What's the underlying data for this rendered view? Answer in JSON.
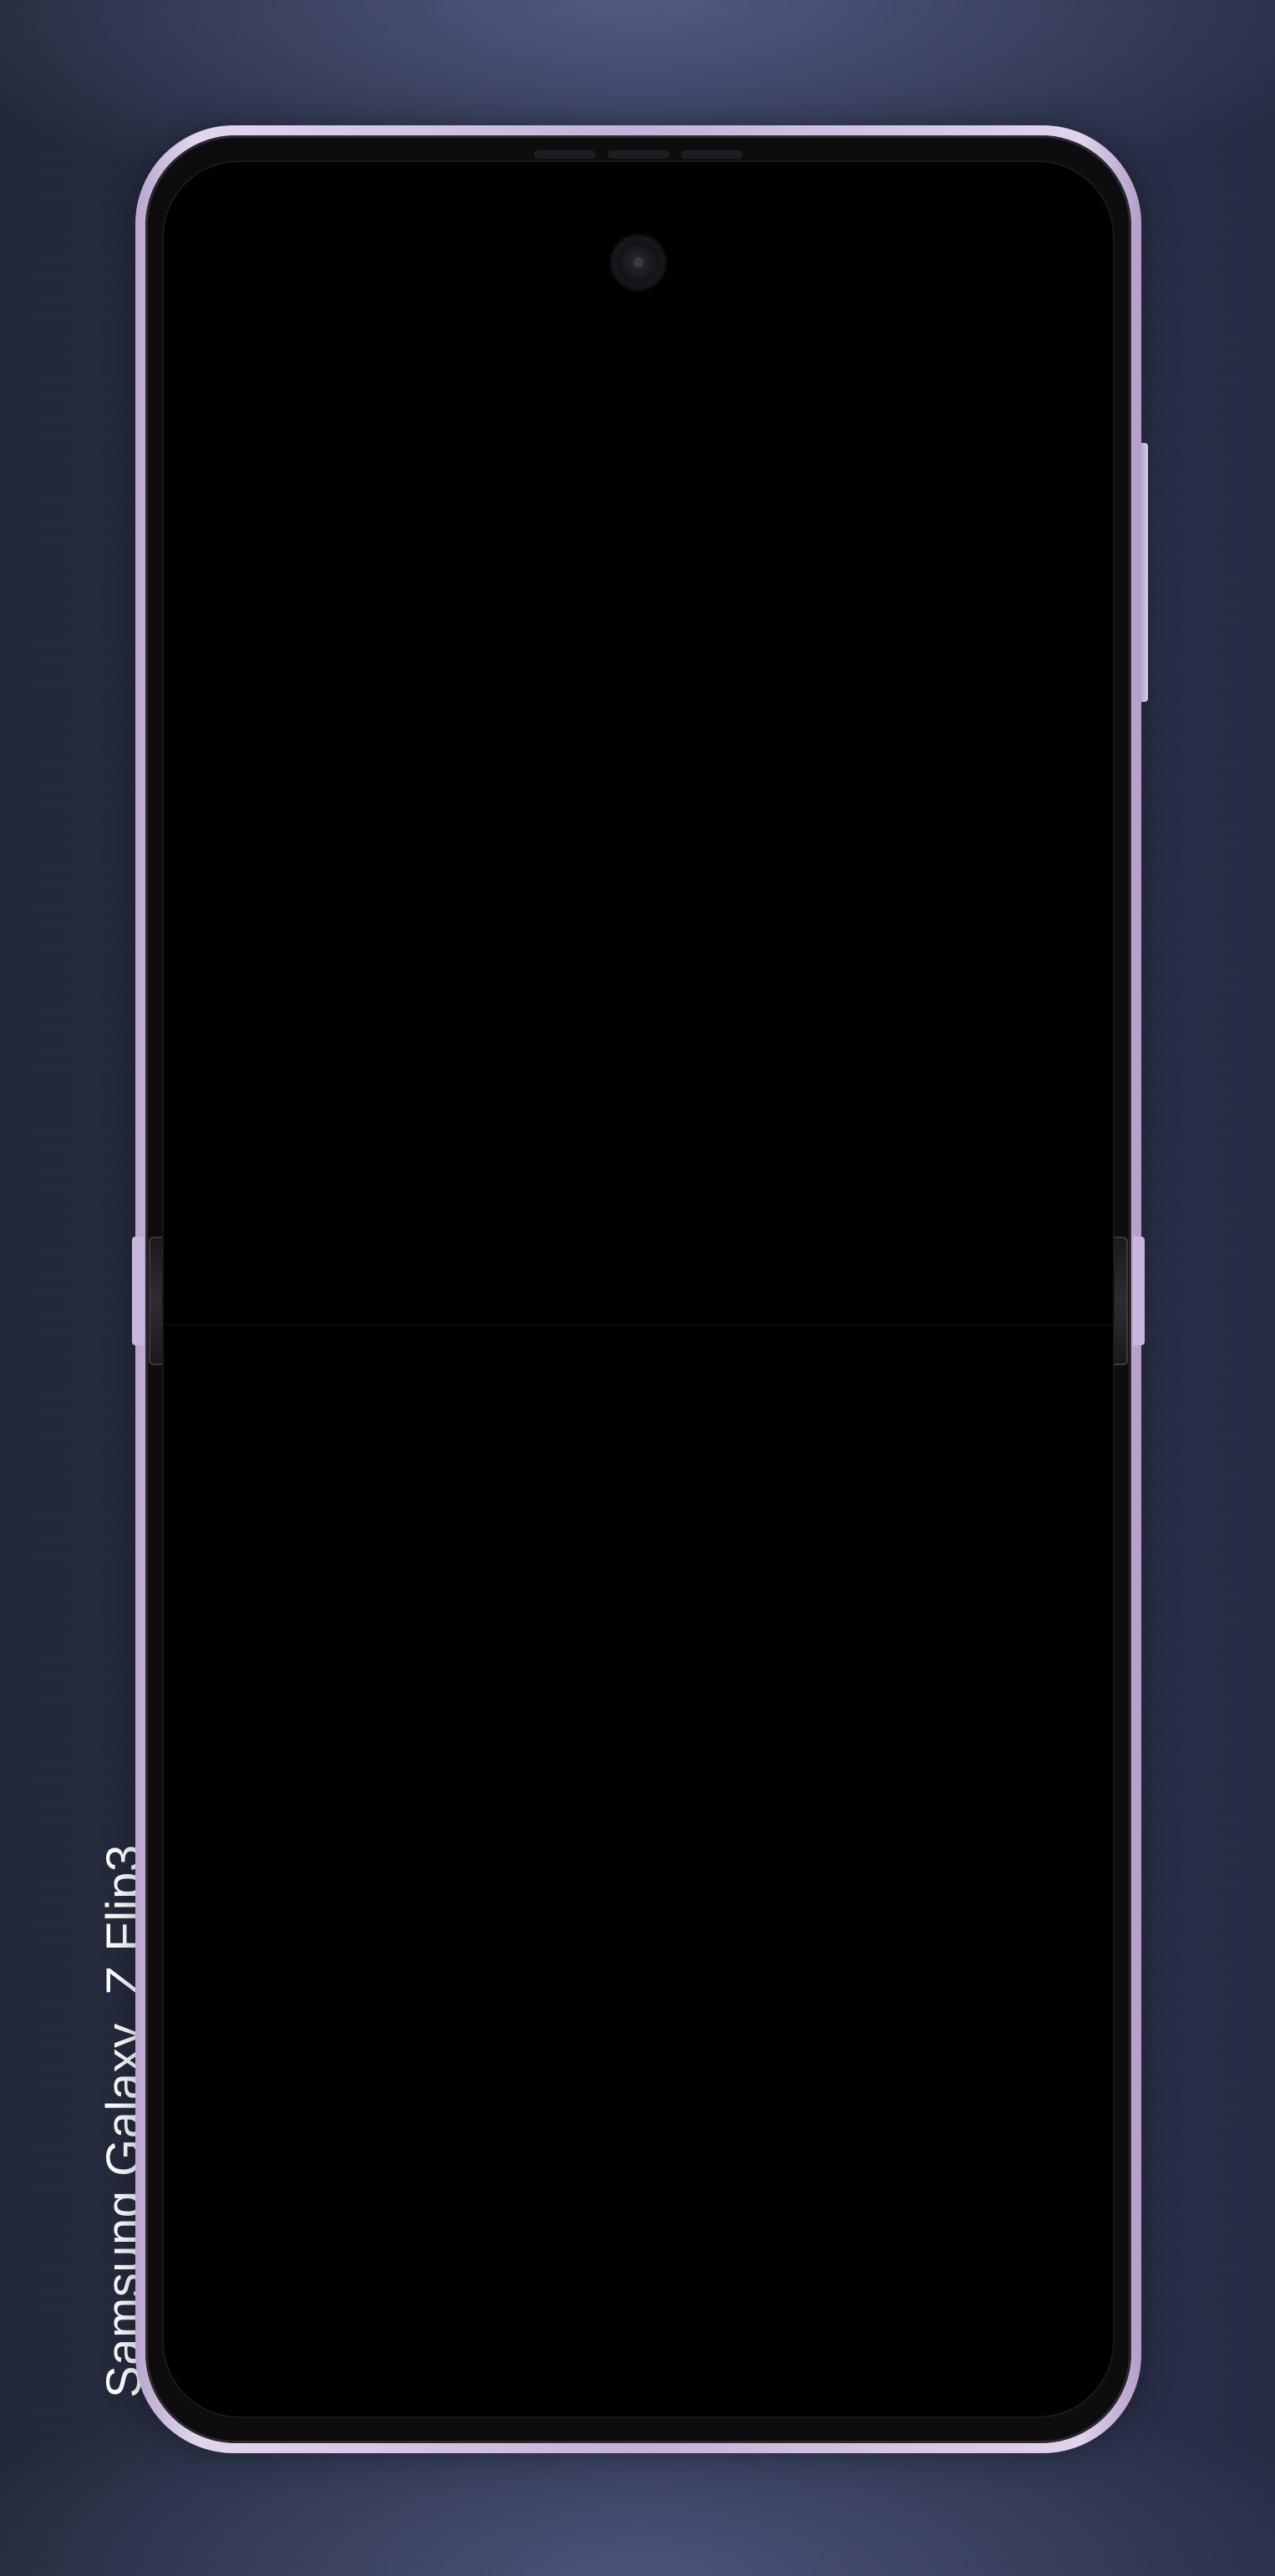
{
  "device": {
    "brand_label": "Samsung Galaxy  Z Flip3",
    "frame_color": "#c4b2d8",
    "screen_color": "#000000",
    "background_color": "#2a3045"
  }
}
